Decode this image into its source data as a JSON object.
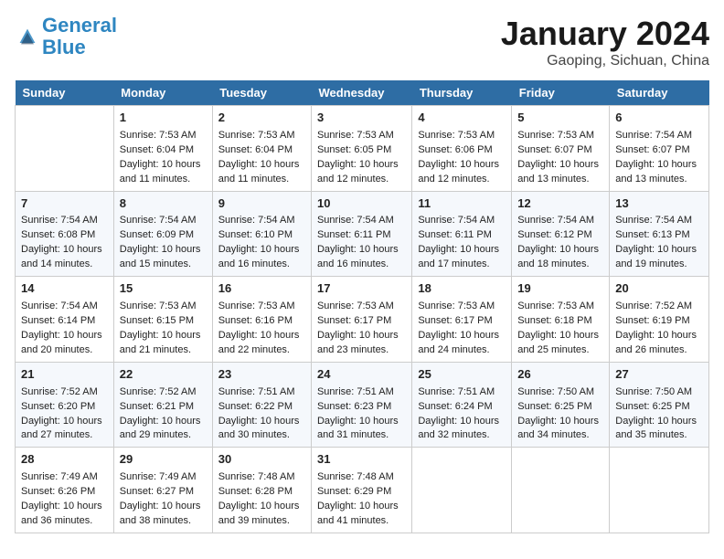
{
  "header": {
    "logo_line1": "General",
    "logo_line2": "Blue",
    "month": "January 2024",
    "location": "Gaoping, Sichuan, China"
  },
  "weekdays": [
    "Sunday",
    "Monday",
    "Tuesday",
    "Wednesday",
    "Thursday",
    "Friday",
    "Saturday"
  ],
  "weeks": [
    [
      {
        "day": null
      },
      {
        "day": 1,
        "sunrise": "Sunrise: 7:53 AM",
        "sunset": "Sunset: 6:04 PM",
        "daylight": "Daylight: 10 hours and 11 minutes."
      },
      {
        "day": 2,
        "sunrise": "Sunrise: 7:53 AM",
        "sunset": "Sunset: 6:04 PM",
        "daylight": "Daylight: 10 hours and 11 minutes."
      },
      {
        "day": 3,
        "sunrise": "Sunrise: 7:53 AM",
        "sunset": "Sunset: 6:05 PM",
        "daylight": "Daylight: 10 hours and 12 minutes."
      },
      {
        "day": 4,
        "sunrise": "Sunrise: 7:53 AM",
        "sunset": "Sunset: 6:06 PM",
        "daylight": "Daylight: 10 hours and 12 minutes."
      },
      {
        "day": 5,
        "sunrise": "Sunrise: 7:53 AM",
        "sunset": "Sunset: 6:07 PM",
        "daylight": "Daylight: 10 hours and 13 minutes."
      },
      {
        "day": 6,
        "sunrise": "Sunrise: 7:54 AM",
        "sunset": "Sunset: 6:07 PM",
        "daylight": "Daylight: 10 hours and 13 minutes."
      }
    ],
    [
      {
        "day": 7,
        "sunrise": "Sunrise: 7:54 AM",
        "sunset": "Sunset: 6:08 PM",
        "daylight": "Daylight: 10 hours and 14 minutes."
      },
      {
        "day": 8,
        "sunrise": "Sunrise: 7:54 AM",
        "sunset": "Sunset: 6:09 PM",
        "daylight": "Daylight: 10 hours and 15 minutes."
      },
      {
        "day": 9,
        "sunrise": "Sunrise: 7:54 AM",
        "sunset": "Sunset: 6:10 PM",
        "daylight": "Daylight: 10 hours and 16 minutes."
      },
      {
        "day": 10,
        "sunrise": "Sunrise: 7:54 AM",
        "sunset": "Sunset: 6:11 PM",
        "daylight": "Daylight: 10 hours and 16 minutes."
      },
      {
        "day": 11,
        "sunrise": "Sunrise: 7:54 AM",
        "sunset": "Sunset: 6:11 PM",
        "daylight": "Daylight: 10 hours and 17 minutes."
      },
      {
        "day": 12,
        "sunrise": "Sunrise: 7:54 AM",
        "sunset": "Sunset: 6:12 PM",
        "daylight": "Daylight: 10 hours and 18 minutes."
      },
      {
        "day": 13,
        "sunrise": "Sunrise: 7:54 AM",
        "sunset": "Sunset: 6:13 PM",
        "daylight": "Daylight: 10 hours and 19 minutes."
      }
    ],
    [
      {
        "day": 14,
        "sunrise": "Sunrise: 7:54 AM",
        "sunset": "Sunset: 6:14 PM",
        "daylight": "Daylight: 10 hours and 20 minutes."
      },
      {
        "day": 15,
        "sunrise": "Sunrise: 7:53 AM",
        "sunset": "Sunset: 6:15 PM",
        "daylight": "Daylight: 10 hours and 21 minutes."
      },
      {
        "day": 16,
        "sunrise": "Sunrise: 7:53 AM",
        "sunset": "Sunset: 6:16 PM",
        "daylight": "Daylight: 10 hours and 22 minutes."
      },
      {
        "day": 17,
        "sunrise": "Sunrise: 7:53 AM",
        "sunset": "Sunset: 6:17 PM",
        "daylight": "Daylight: 10 hours and 23 minutes."
      },
      {
        "day": 18,
        "sunrise": "Sunrise: 7:53 AM",
        "sunset": "Sunset: 6:17 PM",
        "daylight": "Daylight: 10 hours and 24 minutes."
      },
      {
        "day": 19,
        "sunrise": "Sunrise: 7:53 AM",
        "sunset": "Sunset: 6:18 PM",
        "daylight": "Daylight: 10 hours and 25 minutes."
      },
      {
        "day": 20,
        "sunrise": "Sunrise: 7:52 AM",
        "sunset": "Sunset: 6:19 PM",
        "daylight": "Daylight: 10 hours and 26 minutes."
      }
    ],
    [
      {
        "day": 21,
        "sunrise": "Sunrise: 7:52 AM",
        "sunset": "Sunset: 6:20 PM",
        "daylight": "Daylight: 10 hours and 27 minutes."
      },
      {
        "day": 22,
        "sunrise": "Sunrise: 7:52 AM",
        "sunset": "Sunset: 6:21 PM",
        "daylight": "Daylight: 10 hours and 29 minutes."
      },
      {
        "day": 23,
        "sunrise": "Sunrise: 7:51 AM",
        "sunset": "Sunset: 6:22 PM",
        "daylight": "Daylight: 10 hours and 30 minutes."
      },
      {
        "day": 24,
        "sunrise": "Sunrise: 7:51 AM",
        "sunset": "Sunset: 6:23 PM",
        "daylight": "Daylight: 10 hours and 31 minutes."
      },
      {
        "day": 25,
        "sunrise": "Sunrise: 7:51 AM",
        "sunset": "Sunset: 6:24 PM",
        "daylight": "Daylight: 10 hours and 32 minutes."
      },
      {
        "day": 26,
        "sunrise": "Sunrise: 7:50 AM",
        "sunset": "Sunset: 6:25 PM",
        "daylight": "Daylight: 10 hours and 34 minutes."
      },
      {
        "day": 27,
        "sunrise": "Sunrise: 7:50 AM",
        "sunset": "Sunset: 6:25 PM",
        "daylight": "Daylight: 10 hours and 35 minutes."
      }
    ],
    [
      {
        "day": 28,
        "sunrise": "Sunrise: 7:49 AM",
        "sunset": "Sunset: 6:26 PM",
        "daylight": "Daylight: 10 hours and 36 minutes."
      },
      {
        "day": 29,
        "sunrise": "Sunrise: 7:49 AM",
        "sunset": "Sunset: 6:27 PM",
        "daylight": "Daylight: 10 hours and 38 minutes."
      },
      {
        "day": 30,
        "sunrise": "Sunrise: 7:48 AM",
        "sunset": "Sunset: 6:28 PM",
        "daylight": "Daylight: 10 hours and 39 minutes."
      },
      {
        "day": 31,
        "sunrise": "Sunrise: 7:48 AM",
        "sunset": "Sunset: 6:29 PM",
        "daylight": "Daylight: 10 hours and 41 minutes."
      },
      {
        "day": null
      },
      {
        "day": null
      },
      {
        "day": null
      }
    ]
  ]
}
